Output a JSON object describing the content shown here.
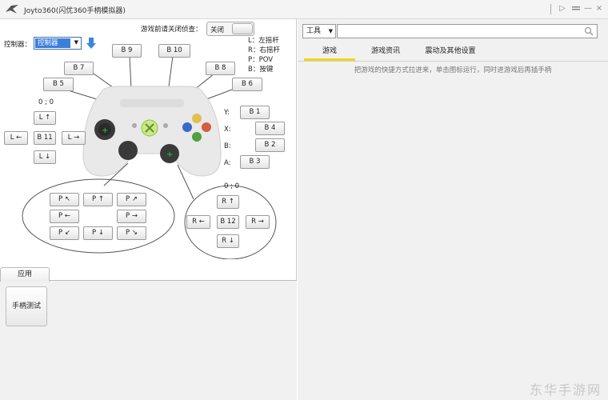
{
  "window": {
    "title": "Joyto360(闪优360手柄模拟器)",
    "controls": [
      "▷",
      "—",
      "×"
    ]
  },
  "left": {
    "controller_label": "控制器：",
    "controller_value": "控制器",
    "close_tip": "游戏前请关闭侦查：",
    "toggle_label": "关闭",
    "legend": [
      "L：左摇杆",
      "R：右摇杆",
      "P：POV",
      "B：按键"
    ],
    "buttons": {
      "b9": "B 9",
      "b10": "B 10",
      "b7": "B 7",
      "b8": "B 8",
      "b5": "B 5",
      "b6": "B 6",
      "b1": "B 1",
      "b4": "B 4",
      "b2": "B 2",
      "b3": "B 3",
      "b11": "B 11",
      "b12": "B 12",
      "l_up": "L ↑",
      "l_left": "L ←",
      "l_right": "L →",
      "l_down": "L ↓",
      "r_up": "R ↑",
      "r_left": "R ←",
      "r_right": "R →",
      "r_down": "R ↓",
      "p_ul": "P ↖",
      "p_up": "P ↑",
      "p_ur": "P ↗",
      "p_left": "P ←",
      "p_right": "P →",
      "p_dl": "P ↙",
      "p_down": "P ↓",
      "p_dr": "P ↘"
    },
    "axis_labels": {
      "y": "Y:",
      "x": "X:",
      "b": "B:",
      "a": "A:"
    },
    "l_coords": "0 ; 0",
    "r_coords": "0 ; 0",
    "app_tab": "应用",
    "app_tile": "手柄测试"
  },
  "right": {
    "tool_select": "工具",
    "search_placeholder": "",
    "tabs": [
      "游戏",
      "游戏资讯",
      "震动及其他设置"
    ],
    "hint": "把游戏的快捷方式拉进来，单击图标运行，同时进游戏后再插手柄"
  },
  "watermark": "东华手游网",
  "colors": {
    "accent": "#3c7fd8",
    "tab_highlight": "#f1d61b"
  }
}
